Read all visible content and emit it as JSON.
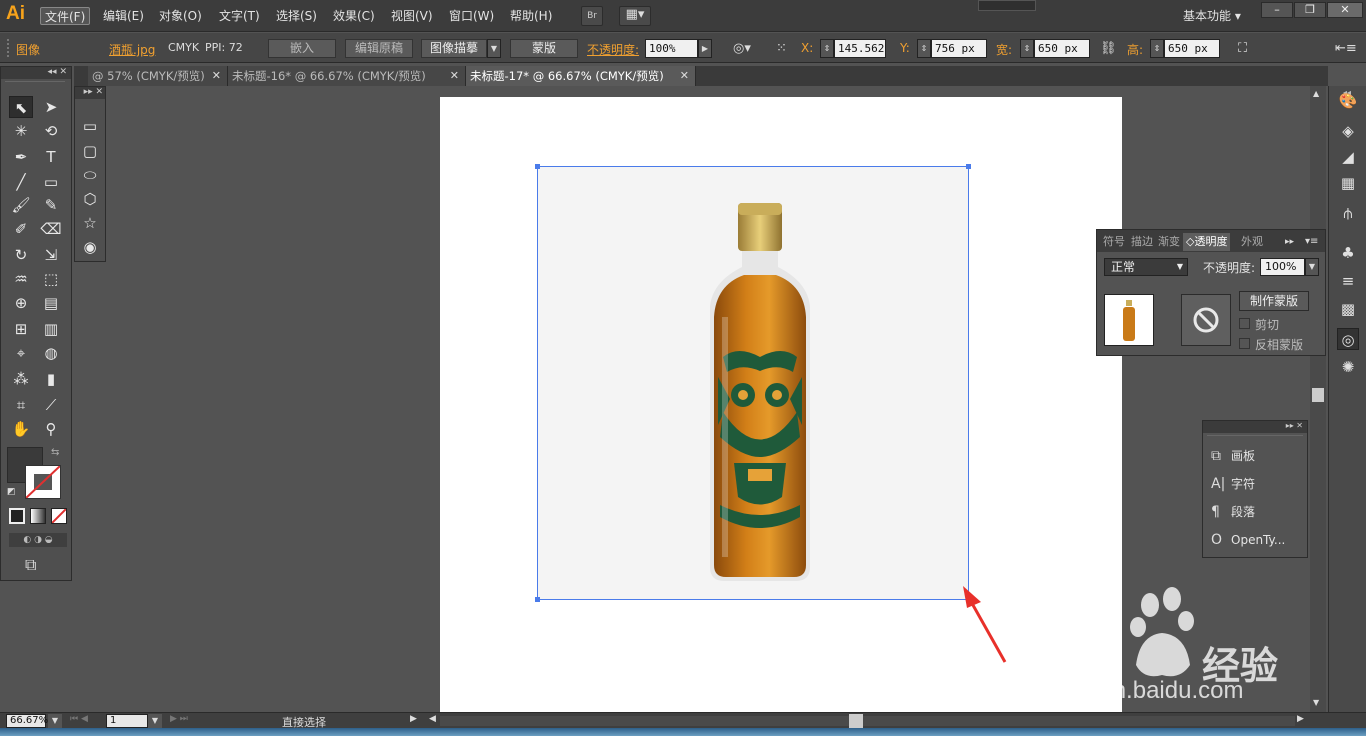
{
  "app": {
    "logo": "Ai",
    "workspace": "基本功能",
    "bridge": "Br"
  },
  "menu": [
    "文件(F)",
    "编辑(E)",
    "对象(O)",
    "文字(T)",
    "选择(S)",
    "效果(C)",
    "视图(V)",
    "窗口(W)",
    "帮助(H)"
  ],
  "window_controls": {
    "minimize": "–",
    "restore": "❐",
    "close": "✕"
  },
  "control_bar": {
    "object_type": "图像",
    "file_name": "酒瓶.jpg",
    "color_mode": "CMYK",
    "ppi": "PPI: 72",
    "embed_button": "嵌入",
    "edit_original_button": "编辑原稿",
    "image_trace_button": "图像描摹",
    "mask_button": "蒙版",
    "opacity_label": "不透明度:",
    "opacity_value": "100%",
    "x_label": "X:",
    "x_value": "145.562",
    "y_label": "Y:",
    "y_value": "756 px",
    "w_label": "宽:",
    "w_value": "650 px",
    "h_label": "高:",
    "h_value": "650 px"
  },
  "tabs": [
    {
      "label": "@ 57% (CMYK/预览)",
      "active": false
    },
    {
      "label": "未标题-16* @ 66.67% (CMYK/预览)",
      "active": false
    },
    {
      "label": "未标题-17* @ 66.67% (CMYK/预览)",
      "active": true
    }
  ],
  "transparency_panel": {
    "tabs": [
      "符号",
      "描边",
      "渐变",
      "透明度",
      "外观"
    ],
    "active_tab": "透明度",
    "blend_mode": "正常",
    "opacity_label": "不透明度:",
    "opacity_value": "100%",
    "make_mask_button": "制作蒙版",
    "clip_label": "剪切",
    "invert_mask_label": "反相蒙版"
  },
  "artboard_panel": {
    "items": [
      {
        "icon": "artboard-icon",
        "label": "画板"
      },
      {
        "icon": "character-icon",
        "label": "字符"
      },
      {
        "icon": "paragraph-icon",
        "label": "段落"
      },
      {
        "icon": "opentype-icon",
        "label": "OpenTy..."
      }
    ]
  },
  "status_bar": {
    "zoom": "66.67%",
    "artboard_number": "1",
    "tool_name": "直接选择"
  },
  "watermark": {
    "brand": "Bai",
    "brand2": "经验",
    "url": "jingyan.baidu.com"
  },
  "colors": {
    "accent_orange": "#f7a31b",
    "selection_blue": "#4a7bea",
    "arrow_red": "#e8302a"
  }
}
